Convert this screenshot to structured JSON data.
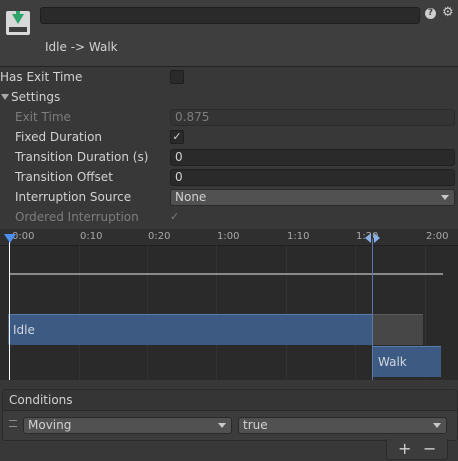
{
  "header": {
    "title": "Idle -> Walk",
    "name_value": ""
  },
  "has_exit_time": {
    "label": "Has Exit Time",
    "checked": false
  },
  "settings": {
    "label": "Settings",
    "exit_time": {
      "label": "Exit Time",
      "value": "0.875"
    },
    "fixed_duration": {
      "label": "Fixed Duration",
      "checked": true,
      "mark": "✓"
    },
    "transition_duration": {
      "label": "Transition Duration (s)",
      "value": "0"
    },
    "transition_offset": {
      "label": "Transition Offset",
      "value": "0"
    },
    "interruption_source": {
      "label": "Interruption Source",
      "value": "None"
    },
    "ordered_interruption": {
      "label": "Ordered Interruption",
      "checked": true,
      "mark": "✓"
    }
  },
  "timeline": {
    "ticks": [
      "0:00",
      "0:10",
      "0:20",
      "1:00",
      "1:10",
      "1:20",
      "2:00"
    ],
    "states": {
      "source": "Idle",
      "destination": "Walk"
    }
  },
  "conditions": {
    "header": "Conditions",
    "items": [
      {
        "parameter": "Moving",
        "value": "true"
      }
    ],
    "add_label": "+",
    "remove_label": "−"
  },
  "colors": {
    "accent": "#3c5a82",
    "background": "#383838",
    "playhead": "#4d8ef0"
  }
}
